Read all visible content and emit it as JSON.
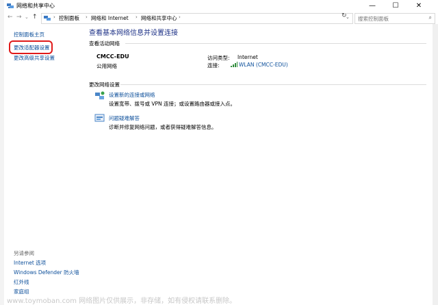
{
  "window": {
    "title": "网络和共享中心",
    "minimize": "—",
    "maximize": "☐",
    "close": "✕"
  },
  "address": {
    "back": "←",
    "forward": "→",
    "recent": "⌄",
    "up": "↑",
    "crumbs": [
      "控制面板",
      "网络和 Internet",
      "网络和共享中心"
    ],
    "separator": "›",
    "dropdown": "⌄",
    "refresh": "↻",
    "search_placeholder": "搜索控制面板",
    "search_icon": "⌕"
  },
  "sidebar": {
    "items": [
      "控制面板主页",
      "更改适配器设置",
      "更改高级共享设置"
    ],
    "see_also_label": "另请参阅",
    "see_also": [
      "Internet 选项",
      "Windows Defender 防火墙",
      "红外线",
      "家庭组"
    ]
  },
  "main": {
    "title": "查看基本网络信息并设置连接",
    "active_networks_label": "查看活动网络",
    "network": {
      "name": "CMCC-EDU",
      "type": "公用网络",
      "access_label": "访问类型:",
      "access_value": "Internet",
      "connection_label": "连接:",
      "connection_value": "WLAN (CMCC-EDU)"
    },
    "change_settings_label": "更改网络设置",
    "options": [
      {
        "link": "设置新的连接或网络",
        "desc": "设置宽带、拨号或 VPN 连接；或设置路由器或接入点。"
      },
      {
        "link": "问题疑难解答",
        "desc": "诊断并修复网络问题，或者获得疑难解答信息。"
      }
    ]
  },
  "watermark": "www.toymoban.com 网络图片仅供展示，非存储，如有侵权请联系删除。",
  "colors": {
    "link": "#0b4e9a",
    "heading": "#1e3287",
    "highlight": "#e01a1a"
  }
}
